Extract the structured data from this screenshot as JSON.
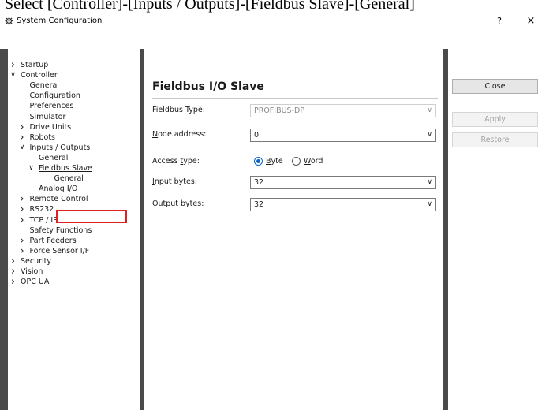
{
  "caption": "Select [Controller]-[Inputs / Outputs]-[Fieldbus Slave]-[General]",
  "window": {
    "title": "System Configuration",
    "help": "?",
    "close": "×"
  },
  "tree": [
    {
      "label": "Startup",
      "level": 0,
      "expander": "collapsed"
    },
    {
      "label": "Controller",
      "level": 0,
      "expander": "expanded"
    },
    {
      "label": "General",
      "level": 1,
      "expander": "none"
    },
    {
      "label": "Configuration",
      "level": 1,
      "expander": "none"
    },
    {
      "label": "Preferences",
      "level": 1,
      "expander": "none"
    },
    {
      "label": "Simulator",
      "level": 1,
      "expander": "none"
    },
    {
      "label": "Drive Units",
      "level": 1,
      "expander": "collapsed"
    },
    {
      "label": "Robots",
      "level": 1,
      "expander": "collapsed"
    },
    {
      "label": "Inputs / Outputs",
      "level": 1,
      "expander": "expanded"
    },
    {
      "label": "General",
      "level": 2,
      "expander": "none"
    },
    {
      "label": "Fieldbus Slave",
      "level": 2,
      "expander": "expanded",
      "underline": true
    },
    {
      "label": "General",
      "level": 3,
      "expander": "none",
      "selected": true
    },
    {
      "label": "Analog I/O",
      "level": 2,
      "expander": "none"
    },
    {
      "label": "Remote Control",
      "level": 1,
      "expander": "collapsed"
    },
    {
      "label": "RS232",
      "level": 1,
      "expander": "collapsed"
    },
    {
      "label": "TCP / IP",
      "level": 1,
      "expander": "collapsed"
    },
    {
      "label": "Safety Functions",
      "level": 1,
      "expander": "none"
    },
    {
      "label": "Part Feeders",
      "level": 1,
      "expander": "collapsed"
    },
    {
      "label": "Force Sensor I/F",
      "level": 1,
      "expander": "collapsed"
    },
    {
      "label": "Security",
      "level": 0,
      "expander": "collapsed"
    },
    {
      "label": "Vision",
      "level": 0,
      "expander": "collapsed"
    },
    {
      "label": "OPC UA",
      "level": 0,
      "expander": "collapsed"
    }
  ],
  "panel": {
    "title": "Fieldbus I/O Slave",
    "fieldbus_type_label": "Fieldbus Type:",
    "fieldbus_type_value": "PROFIBUS-DP",
    "node_address_label": "Node address:",
    "node_address_value": "0",
    "access_type_label": "Access type:",
    "access_byte": "Byte",
    "access_word": "Word",
    "access_selected": "Byte",
    "input_bytes_label": "Input bytes:",
    "input_bytes_value": "32",
    "output_bytes_label": "Output bytes:",
    "output_bytes_value": "32"
  },
  "buttons": {
    "close": "Close",
    "apply": "Apply",
    "restore": "Restore"
  },
  "icons": {
    "expanded": "chevron-down-icon",
    "collapsed": "chevron-right-icon",
    "dropdown": "chevron-down-icon",
    "app": "gear-icon"
  },
  "colors": {
    "highlight": "#e02020",
    "radio_accent": "#0a64c8",
    "splitter": "#4a4a4a"
  }
}
